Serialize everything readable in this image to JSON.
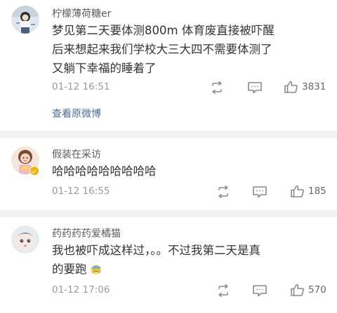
{
  "comments": [
    {
      "user": "柠檬薄荷糖er",
      "lines": [
        "梦见第二天要体测800m 体育废直接被吓醒",
        "后来想起来我们学校大三大四不需要体测了",
        "又躺下幸福的睡着了"
      ],
      "time": "01-12 16:51",
      "likes": "3831",
      "link": "查看原微博"
    },
    {
      "user": "假装在采访",
      "lines": [
        "哈哈哈哈哈哈哈哈哈"
      ],
      "time": "01-12 16:55",
      "likes": "185",
      "verified": true
    },
    {
      "user": "药药药药爱橘猫",
      "lines": [
        "我也被吓成这样过，。。不过我第二天是真",
        "的要跑"
      ],
      "time": "01-12 17:06",
      "likes": "570",
      "emoji": "crying-face-emoji"
    }
  ],
  "icons": [
    "repost-icon",
    "comment-icon",
    "like-icon"
  ],
  "colors": {
    "name": "#5c5c5c",
    "body": "#333333",
    "meta": "#999999",
    "link": "#4a6b9a",
    "separator": "#f2f2f2",
    "verified_badge": "#f5b400"
  }
}
